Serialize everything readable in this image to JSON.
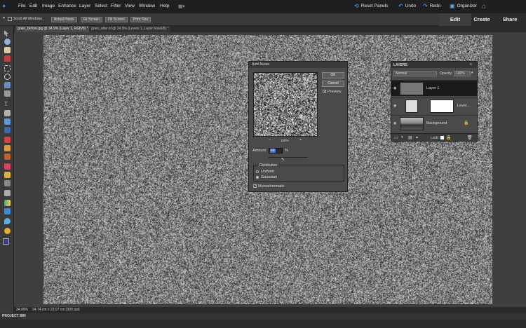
{
  "menu": [
    "File",
    "Edit",
    "Image",
    "Enhance",
    "Layer",
    "Select",
    "Filter",
    "View",
    "Window",
    "Help"
  ],
  "toolbar_right": {
    "reset_panels": "Reset Panels",
    "undo": "Undo",
    "redo": "Redo",
    "organizer": "Organizer"
  },
  "mode_tabs": [
    "Edit",
    "Create",
    "Share"
  ],
  "options": {
    "scroll_all": "Scroll All Windows",
    "actual_pixels": "Actual Pixels",
    "fit_screen": "Fit Screen",
    "fill_screen": "Fill Screen",
    "print_size": "Print Size"
  },
  "doc_tabs": [
    "grain_before.jpg @ 34.9% (Layer 1, RGB/8) *",
    "grain_after.tif @ 34.9% (Levels 1, Layer Mask/8) *"
  ],
  "dialog": {
    "title": "Add Noise",
    "ok": "OK",
    "cancel": "Cancel",
    "preview_label": "Preview",
    "zoom": "100%",
    "minus": "–",
    "plus": "+",
    "amount_label": "Amount:",
    "amount_value": "60",
    "amount_unit": "%",
    "distribution_label": "Distribution",
    "uniform": "Uniform",
    "gaussian": "Gaussian",
    "monochromatic": "Monochromatic"
  },
  "layers": {
    "panel_title": "LAYERS",
    "blend_mode": "Normal",
    "opacity_label": "Opacity:",
    "opacity_value": "100%",
    "lock_label": "Lock:",
    "items": [
      {
        "name": "Layer 1"
      },
      {
        "name": "Level..."
      },
      {
        "name": "Background"
      }
    ]
  },
  "status": {
    "zoom": "34.99%",
    "doc_info": "34.74 cm x 23.07 cm (300 ppi)"
  },
  "project_bin": "PROJECT BIN",
  "colors": {
    "accent": "#3d6fd6",
    "bg": "#2b2b2b"
  }
}
